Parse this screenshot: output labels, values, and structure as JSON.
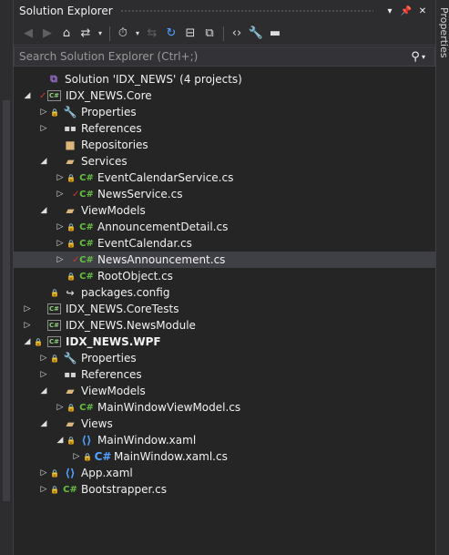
{
  "window": {
    "title": "Solution Explorer",
    "right_tab": "Properties"
  },
  "search": {
    "placeholder": "Search Solution Explorer (Ctrl+;)"
  },
  "tree": [
    {
      "label": "Solution 'IDX_NEWS' (4 projects)",
      "icon": "solution-icon",
      "glyph": "⧉",
      "cls": "sln",
      "level": 0,
      "expander": "",
      "lock": false,
      "check": false
    },
    {
      "label": "IDX_NEWS.Core",
      "icon": "csharp-project-icon",
      "glyph": "C#",
      "cls": "csproj",
      "level": 0,
      "expander": "◢",
      "lock": false,
      "check": true
    },
    {
      "label": "Properties",
      "icon": "wrench-icon",
      "glyph": "🔧",
      "cls": "wrench",
      "level": 1,
      "expander": "▷",
      "lock": true,
      "check": false
    },
    {
      "label": "References",
      "icon": "references-icon",
      "glyph": "▪▪",
      "cls": "refs",
      "level": 1,
      "expander": "▷",
      "lock": false,
      "check": false
    },
    {
      "label": "Repositories",
      "icon": "folder-icon",
      "glyph": "■",
      "cls": "folder",
      "level": 1,
      "expander": "",
      "lock": false,
      "check": false
    },
    {
      "label": "Services",
      "icon": "folder-open-icon",
      "glyph": "▰",
      "cls": "folder",
      "level": 1,
      "expander": "◢",
      "lock": false,
      "check": false
    },
    {
      "label": "EventCalendarService.cs",
      "icon": "csharp-file-icon",
      "glyph": "C#",
      "cls": "cs",
      "level": 2,
      "expander": "▷",
      "lock": true,
      "check": false
    },
    {
      "label": "NewsService.cs",
      "icon": "csharp-file-icon",
      "glyph": "C#",
      "cls": "cs",
      "level": 2,
      "expander": "▷",
      "lock": false,
      "check": true
    },
    {
      "label": "ViewModels",
      "icon": "folder-open-icon",
      "glyph": "▰",
      "cls": "folder",
      "level": 1,
      "expander": "◢",
      "lock": false,
      "check": false
    },
    {
      "label": "AnnouncementDetail.cs",
      "icon": "csharp-file-icon",
      "glyph": "C#",
      "cls": "cs",
      "level": 2,
      "expander": "▷",
      "lock": true,
      "check": false
    },
    {
      "label": "EventCalendar.cs",
      "icon": "csharp-file-icon",
      "glyph": "C#",
      "cls": "cs",
      "level": 2,
      "expander": "▷",
      "lock": true,
      "check": false
    },
    {
      "label": "NewsAnnouncement.cs",
      "icon": "csharp-file-icon",
      "glyph": "C#",
      "cls": "cs",
      "level": 2,
      "expander": "▷",
      "lock": false,
      "check": true,
      "selected": true
    },
    {
      "label": "RootObject.cs",
      "icon": "csharp-file-icon",
      "glyph": "C#",
      "cls": "cs",
      "level": 2,
      "expander": "",
      "lock": true,
      "check": false
    },
    {
      "label": "packages.config",
      "icon": "config-file-icon",
      "glyph": "↪",
      "cls": "config",
      "level": 1,
      "expander": "",
      "lock": true,
      "check": false
    },
    {
      "label": "IDX_NEWS.CoreTests",
      "icon": "test-project-icon",
      "glyph": "C#",
      "cls": "csproj",
      "level": 0,
      "expander": "▷",
      "lock": false,
      "check": false
    },
    {
      "label": "IDX_NEWS.NewsModule",
      "icon": "csharp-project-icon",
      "glyph": "C#",
      "cls": "csproj",
      "level": 0,
      "expander": "▷",
      "lock": false,
      "check": false
    },
    {
      "label": "IDX_NEWS.WPF",
      "icon": "csharp-project-icon",
      "glyph": "C#",
      "cls": "csproj",
      "level": 0,
      "expander": "◢",
      "lock": true,
      "check": false,
      "bold": true
    },
    {
      "label": "Properties",
      "icon": "wrench-icon",
      "glyph": "🔧",
      "cls": "wrench",
      "level": 1,
      "expander": "▷",
      "lock": true,
      "check": false
    },
    {
      "label": "References",
      "icon": "references-icon",
      "glyph": "▪▪",
      "cls": "refs",
      "level": 1,
      "expander": "▷",
      "lock": false,
      "check": false
    },
    {
      "label": "ViewModels",
      "icon": "folder-open-icon",
      "glyph": "▰",
      "cls": "folder",
      "level": 1,
      "expander": "◢",
      "lock": false,
      "check": false
    },
    {
      "label": "MainWindowViewModel.cs",
      "icon": "csharp-file-icon",
      "glyph": "C#",
      "cls": "cs",
      "level": 2,
      "expander": "▷",
      "lock": true,
      "check": false
    },
    {
      "label": "Views",
      "icon": "folder-open-icon",
      "glyph": "▰",
      "cls": "folder",
      "level": 1,
      "expander": "◢",
      "lock": false,
      "check": false
    },
    {
      "label": "MainWindow.xaml",
      "icon": "xaml-file-icon",
      "glyph": "⟨⟩",
      "cls": "xaml",
      "level": 2,
      "expander": "◢",
      "lock": true,
      "check": false
    },
    {
      "label": "MainWindow.xaml.cs",
      "icon": "csharp-file-icon",
      "glyph": "C#",
      "cls": "xaml",
      "level": 3,
      "expander": "▷",
      "lock": true,
      "check": false
    },
    {
      "label": "App.xaml",
      "icon": "xaml-file-icon",
      "glyph": "⟨⟩",
      "cls": "xaml",
      "level": 1,
      "expander": "▷",
      "lock": true,
      "check": false
    },
    {
      "label": "Bootstrapper.cs",
      "icon": "csharp-file-icon",
      "glyph": "C#",
      "cls": "cs",
      "level": 1,
      "expander": "▷",
      "lock": true,
      "check": false
    }
  ],
  "colors": {
    "background": "#252526",
    "selection": "#3f3f46",
    "csharp": "#66c040",
    "folder": "#dcb67a",
    "checkmark": "#d13438",
    "lock": "#4fa2ff"
  }
}
